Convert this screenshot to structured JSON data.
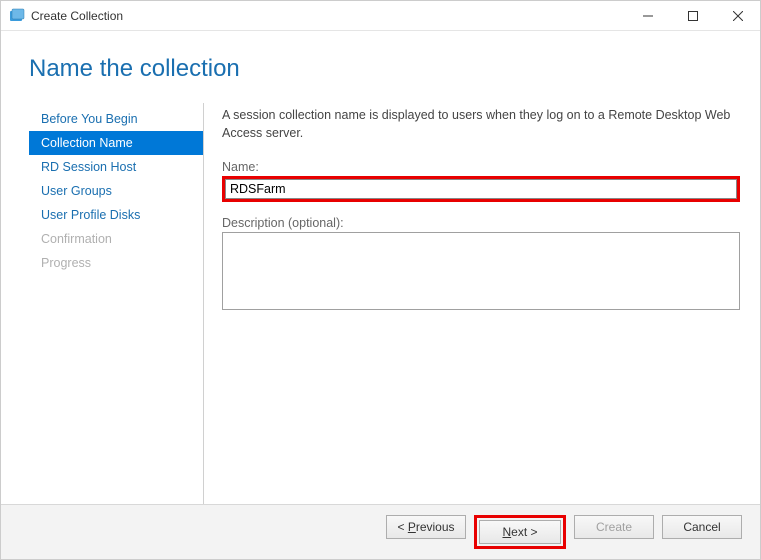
{
  "window": {
    "title": "Create Collection"
  },
  "heading": "Name the collection",
  "sidebar": {
    "steps": [
      {
        "label": "Before You Begin",
        "state": "enabled"
      },
      {
        "label": "Collection Name",
        "state": "active"
      },
      {
        "label": "RD Session Host",
        "state": "enabled"
      },
      {
        "label": "User Groups",
        "state": "enabled"
      },
      {
        "label": "User Profile Disks",
        "state": "enabled"
      },
      {
        "label": "Confirmation",
        "state": "disabled"
      },
      {
        "label": "Progress",
        "state": "disabled"
      }
    ]
  },
  "content": {
    "intro": "A session collection name is displayed to users when they log on to a Remote Desktop Web Access server.",
    "name_label": "Name:",
    "name_value": "RDSFarm",
    "description_label": "Description (optional):",
    "description_value": ""
  },
  "footer": {
    "previous_pre": "< ",
    "previous_u": "P",
    "previous_post": "revious",
    "next_u": "N",
    "next_post": "ext >",
    "create": "Create",
    "cancel": "Cancel"
  }
}
